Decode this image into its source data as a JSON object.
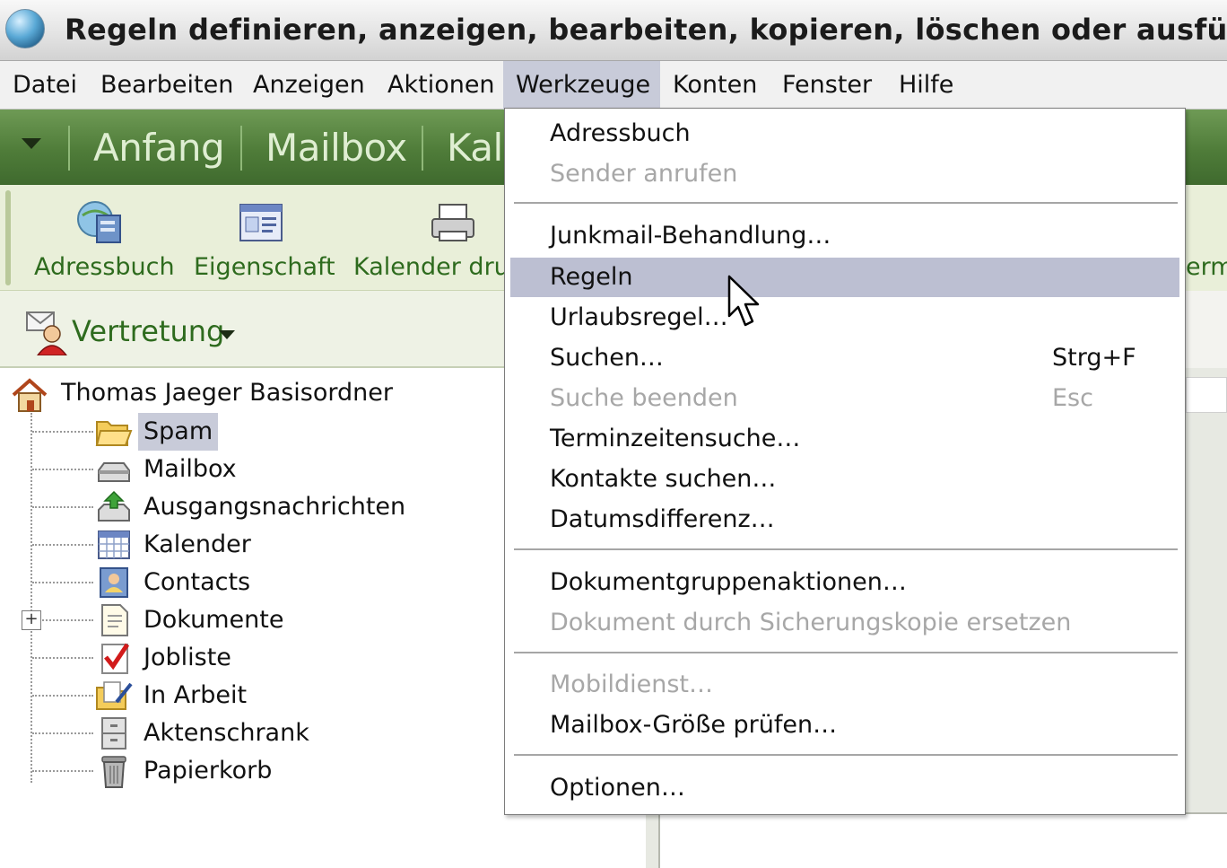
{
  "window": {
    "title": "Regeln definieren, anzeigen, bearbeiten, kopieren, löschen oder ausführen"
  },
  "menubar": {
    "items": [
      "Datei",
      "Bearbeiten",
      "Anzeigen",
      "Aktionen",
      "Werkzeuge",
      "Konten",
      "Fenster",
      "Hilfe"
    ],
    "open": "Werkzeuge"
  },
  "launcher": {
    "tabs": [
      "Anfang",
      "Mailbox",
      "Kal"
    ]
  },
  "toolbar": {
    "buttons": [
      {
        "label": "Adressbuch",
        "icon": "address-book-icon"
      },
      {
        "label": "Eigenschaft",
        "icon": "properties-icon"
      },
      {
        "label": "Kalender dru",
        "icon": "printer-icon"
      }
    ],
    "clipped_right_label": "ermi"
  },
  "delegate": {
    "label": "Vertretung",
    "icon": "delegate-user-icon"
  },
  "tree": {
    "root": {
      "label": "Thomas Jaeger Basisordner",
      "icon": "home-icon"
    },
    "items": [
      {
        "label": "Spam",
        "icon": "open-folder-icon",
        "selected": true
      },
      {
        "label": "Mailbox",
        "icon": "inbox-tray-icon"
      },
      {
        "label": "Ausgangsnachrichten",
        "icon": "outbox-icon"
      },
      {
        "label": "Kalender",
        "icon": "calendar-icon"
      },
      {
        "label": "Contacts",
        "icon": "contacts-icon"
      },
      {
        "label": "Dokumente",
        "icon": "documents-icon",
        "expandable": true
      },
      {
        "label": "Jobliste",
        "icon": "checklist-icon"
      },
      {
        "label": "In Arbeit",
        "icon": "work-in-progress-icon"
      },
      {
        "label": "Aktenschrank",
        "icon": "filing-cabinet-icon"
      },
      {
        "label": "Papierkorb",
        "icon": "trash-can-icon"
      }
    ],
    "expander_symbol": "+"
  },
  "dropdown": {
    "items": {
      "adressbuch": {
        "label": "Adressbuch"
      },
      "sender_anrufen": {
        "label": "Sender anrufen",
        "disabled": true
      },
      "junkmail": {
        "label": "Junkmail-Behandlung…"
      },
      "regeln": {
        "label": "Regeln",
        "hover": true
      },
      "urlaubsregel": {
        "label": "Urlaubsregel…"
      },
      "suchen": {
        "label": "Suchen…",
        "shortcut": "Strg+F"
      },
      "suche_beenden": {
        "label": "Suche beenden",
        "shortcut": "Esc",
        "disabled": true
      },
      "terminzeitensuche": {
        "label": "Terminzeitensuche…"
      },
      "kontakte_suchen": {
        "label": "Kontakte suchen…"
      },
      "datumsdifferenz": {
        "label": "Datumsdifferenz…"
      },
      "dokumentgruppenaktionen": {
        "label": "Dokumentgruppenaktionen…"
      },
      "dokument_ersetzen": {
        "label": "Dokument durch Sicherungskopie ersetzen",
        "disabled": true
      },
      "mobildienst": {
        "label": "Mobildienst…",
        "disabled": true
      },
      "mailbox_groesse": {
        "label": "Mailbox-Größe prüfen…"
      },
      "optionen": {
        "label": "Optionen…"
      }
    }
  },
  "colors": {
    "launcher_green": "#4f7c39",
    "toolbar_label_green": "#2e6b1e",
    "selection": "#c8cbd9",
    "menu_hover": "#bcbfd2",
    "disabled_text": "#a7a7a7"
  }
}
